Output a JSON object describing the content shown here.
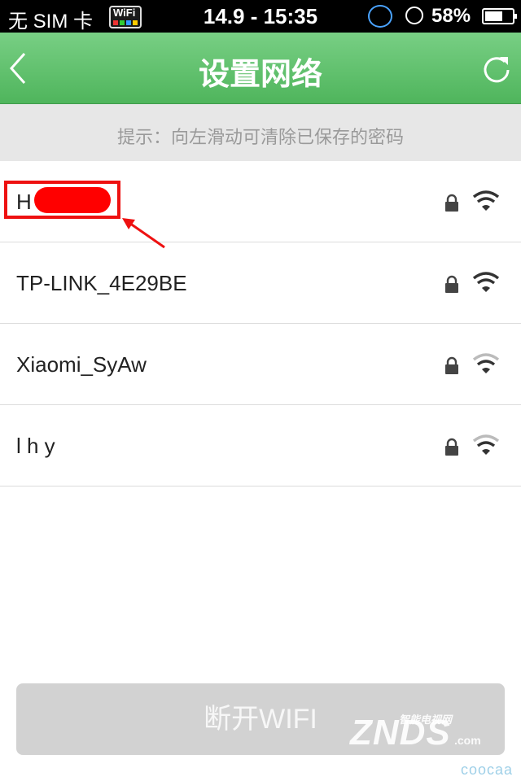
{
  "status_bar": {
    "carrier": "无 SIM 卡",
    "wifi_logo": "WiFi",
    "time": "14.9 - 15:35",
    "battery_percent": "58%",
    "battery_level": 0.58
  },
  "nav": {
    "title": "设置网络",
    "back_icon": "chevron-left-icon",
    "refresh_icon": "refresh-icon"
  },
  "hint": "提示：向左滑动可清除已保存的密码",
  "networks": [
    {
      "ssid": "H",
      "locked": true,
      "signal": "strong",
      "redacted": true
    },
    {
      "ssid": "TP-LINK_4E29BE",
      "locked": true,
      "signal": "strong"
    },
    {
      "ssid": "Xiaomi_SyAw",
      "locked": true,
      "signal": "medium"
    },
    {
      "ssid": "l h y",
      "locked": true,
      "signal": "medium"
    }
  ],
  "disconnect_button": "断开WIFI",
  "watermark": {
    "znds": "ZNDS",
    "znds_com": ".com",
    "znds_cn": "智能电视网",
    "coocaa": "coocaa"
  },
  "colors": {
    "nav_green": "#5cbf68",
    "annotation_red": "#e11111",
    "button_gray": "#d2d2d2"
  }
}
